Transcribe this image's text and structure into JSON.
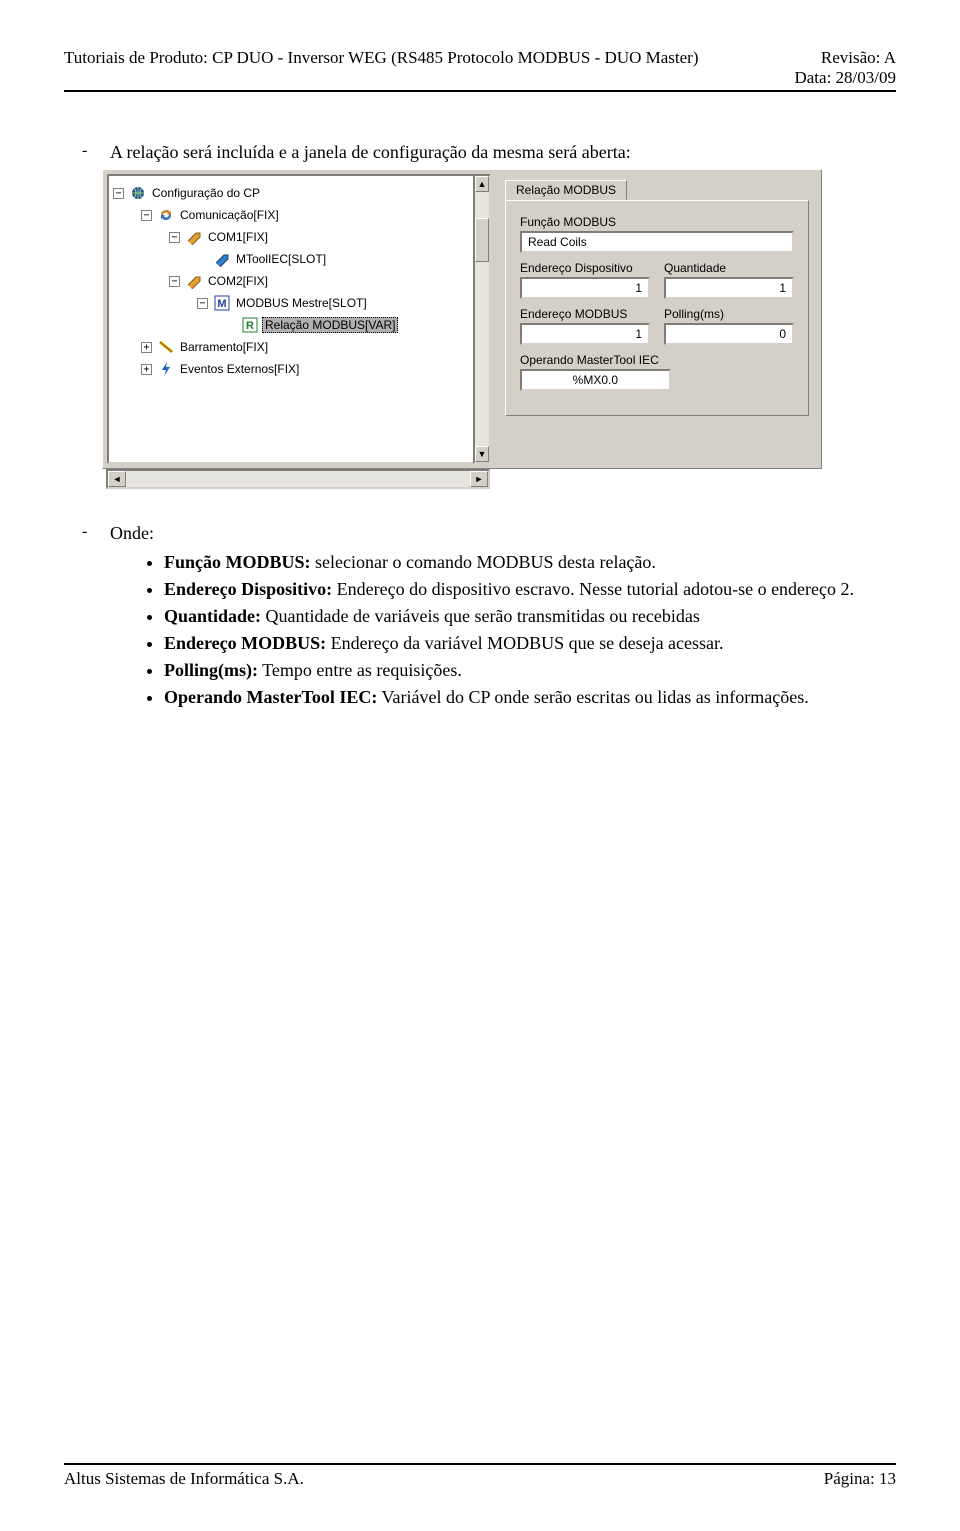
{
  "header": {
    "left": "Tutoriais de Produto: CP DUO - Inversor WEG (RS485 Protocolo MODBUS - DUO Master)",
    "right1": "Revisão: A",
    "right2": "Data: 28/03/09"
  },
  "intro_line": "A relação será incluída e a janela de configuração da mesma será aberta:",
  "tree": {
    "n0": "Configuração do CP",
    "n1": "Comunicação[FIX]",
    "n2": "COM1[FIX]",
    "n3": "MToolIEC[SLOT]",
    "n4": "COM2[FIX]",
    "n5": "MODBUS Mestre[SLOT]",
    "n6": "Relação MODBUS[VAR]",
    "n7": "Barramento[FIX]",
    "n8": "Eventos Externos[FIX]"
  },
  "panel": {
    "tab": "Relação MODBUS",
    "funcao_lbl": "Função MODBUS",
    "funcao_val": "Read Coils",
    "end_disp_lbl": "Endereço Dispositivo",
    "end_disp_val": "1",
    "qtde_lbl": "Quantidade",
    "qtde_val": "1",
    "end_mod_lbl": "Endereço MODBUS",
    "end_mod_val": "1",
    "poll_lbl": "Polling(ms)",
    "poll_val": "0",
    "oper_lbl": "Operando MasterTool IEC",
    "oper_val": "%MX0.0"
  },
  "onde_label": "Onde:",
  "defs": {
    "d1b": "Função MODBUS:",
    "d1t": " selecionar o comando MODBUS desta relação.",
    "d2b": "Endereço Dispositivo:",
    "d2t": " Endereço do dispositivo escravo. Nesse tutorial adotou-se o endereço 2.",
    "d3b": "Quantidade:",
    "d3t": " Quantidade de variáveis que serão transmitidas ou recebidas",
    "d4b": "Endereço MODBUS:",
    "d4t": " Endereço da variável MODBUS que se deseja acessar.",
    "d5b": "Polling(ms):",
    "d5t": " Tempo entre as requisições.",
    "d6b": "Operando MasterTool IEC:",
    "d6t": " Variável do CP onde serão escritas ou lidas as informações."
  },
  "footer": {
    "left": "Altus Sistemas de Informática S.A.",
    "right": "Página: 13"
  }
}
